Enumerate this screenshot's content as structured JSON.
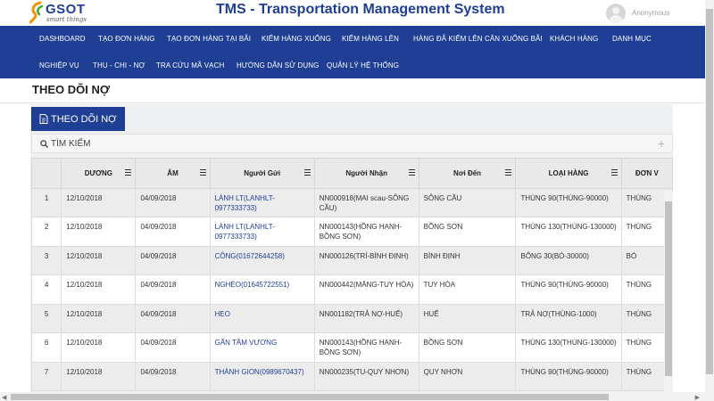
{
  "brand": {
    "logo_text": "GSOT",
    "logo_sub": "smart things"
  },
  "app_title": "TMS - Transportation Management System",
  "user": {
    "name": "Anonymous"
  },
  "nav": {
    "row1": [
      "DASHBOARD",
      "TẠO ĐƠN HÀNG",
      "TẠO ĐƠN HÀNG TẠI BÃI",
      "KIỂM HÀNG XUỐNG",
      "KIỂM HÀNG LÊN",
      "HÀNG ĐÃ KIỂM LÊN CĂN XUỐNG BÃI",
      "KHÁCH HÀNG",
      "DANH MỤC"
    ],
    "row2": [
      "NGHIỆP VỤ",
      "THU - CHI - NỢ",
      "TRA CỨU MÃ VẠCH",
      "HƯỚNG DẪN SỬ DỤNG",
      "QUẢN LÝ HỆ THỐNG"
    ]
  },
  "page": {
    "title": "THEO DÕI NỢ",
    "tab_label": "THEO DÕI NỢ",
    "search_label": "TÌM KIẾM",
    "search_toggle": "+"
  },
  "table": {
    "columns": [
      "",
      "DƯƠNG",
      "ÂM",
      "Người Gửi",
      "Người Nhận",
      "Nơi Đến",
      "LOẠI HÀNG",
      "ĐƠN V"
    ],
    "rows": [
      {
        "no": "1",
        "duong": "12/10/2018",
        "am": "04/09/2018",
        "nguoi_gui": "LÀNH LT(LANHLT-0977333733)",
        "nguoi_nhan": "NN000918(MAI scau-SÔNG CẦU)",
        "noi_den": "SÔNG CẦU",
        "loai_hang": "THÙNG 90(THÙNG-90000)",
        "don_vi": "THÙNG"
      },
      {
        "no": "2",
        "duong": "12/10/2018",
        "am": "04/09/2018",
        "nguoi_gui": "LÀNH LT(LANHLT-0977333733)",
        "nguoi_nhan": "NN000143(HỒNG HẠNH-BỒNG SƠN)",
        "noi_den": "BỒNG SƠN",
        "loai_hang": "THÙNG 130(THÙNG-130000)",
        "don_vi": "THÙNG"
      },
      {
        "no": "3",
        "duong": "12/10/2018",
        "am": "04/09/2018",
        "nguoi_gui": "CÔNG(01672644258)",
        "nguoi_nhan": "NN000126(TRÍ-BÌNH ĐỊNH)",
        "noi_den": "BÌNH ĐỊNH",
        "loai_hang": "BÔNG 30(BÓ-30000)",
        "don_vi": "BÓ"
      },
      {
        "no": "4",
        "duong": "12/10/2018",
        "am": "04/09/2018",
        "nguoi_gui": "NGHÈO(01645722551)",
        "nguoi_nhan": "NN000442(MĂNG-TUY HÒA)",
        "noi_den": "TUY HÒA",
        "loai_hang": "THÙNG 90(THÙNG-90000)",
        "don_vi": "THÙNG"
      },
      {
        "no": "5",
        "duong": "12/10/2018",
        "am": "04/09/2018",
        "nguoi_gui": "HEO",
        "nguoi_nhan": "NN001182(TRẢ NỢ-HUẾ)",
        "noi_den": "HUẾ",
        "loai_hang": "TRẢ NỢ(THÙNG-1000)",
        "don_vi": "THÙNG"
      },
      {
        "no": "6",
        "duong": "12/10/2018",
        "am": "04/09/2018",
        "nguoi_gui": "GẤN TÂM VƯƠNG",
        "nguoi_nhan": "NN000143(HỒNG HẠNH-BỒNG SƠN)",
        "noi_den": "BỒNG SƠN",
        "loai_hang": "THÙNG 130(THÙNG-130000)",
        "don_vi": "THÙNG"
      },
      {
        "no": "7",
        "duong": "12/10/2018",
        "am": "04/09/2018",
        "nguoi_gui": "THÀNH GION(0989670437)",
        "nguoi_nhan": "NN000235(TU-QUY NHƠN)",
        "noi_den": "QUY NHƠN",
        "loai_hang": "THÙNG 90(THÙNG-90000)",
        "don_vi": "THÙNG"
      }
    ]
  },
  "colors": {
    "brand_blue": "#1f3f95",
    "logo_green": "#3aa935",
    "logo_orange": "#f39200"
  }
}
